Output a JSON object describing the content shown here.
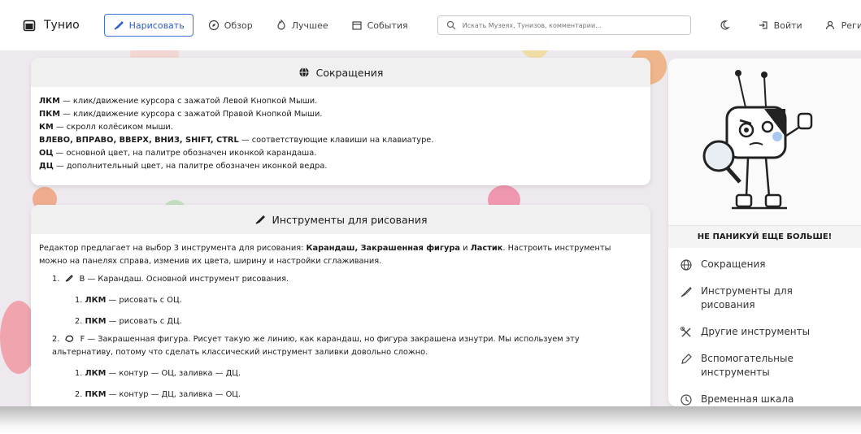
{
  "header": {
    "app_name": "Тунио",
    "nav": [
      {
        "label": "Нарисовать",
        "icon": "brush-icon"
      },
      {
        "label": "Обзор",
        "icon": "compass-icon"
      },
      {
        "label": "Лучшее",
        "icon": "fire-icon"
      },
      {
        "label": "События",
        "icon": "calendar-icon"
      }
    ],
    "search_placeholder": "Искать Музеях, Тунизов, комментарии...",
    "login": "Войти",
    "register": "Регистрация"
  },
  "abbreviations": {
    "title": "Сокращения",
    "lines": [
      {
        "term": "ЛКМ",
        "text": " — клик/движение курсора с зажатой Левой Кнопкой Мыши."
      },
      {
        "term": "ПКМ",
        "text": " — клик/движение курсора с зажатой Правой Кнопкой Мыши."
      },
      {
        "term": "КМ",
        "text": " — скролл колёсиком мыши."
      },
      {
        "term": "ВЛЕВО, ВПРАВО, ВВЕРХ, ВНИЗ, SHIFT, CTRL",
        "text": " — соответствующие клавиши на клавиатуре."
      },
      {
        "term": "ОЦ",
        "text": " — основной цвет, на палитре обозначен иконкой карандаша."
      },
      {
        "term": "ДЦ",
        "text": " — дополнительный цвет, на палитре обозначен иконкой ведра."
      }
    ]
  },
  "tools": {
    "title": "Инструменты для рисования",
    "intro_1": "Редактор предлагает на выбор 3 инструмента для рисования: ",
    "intro_tools": "Карандаш, Закрашенная фигура",
    "intro_and": " и ",
    "intro_eraser": "Ластик",
    "intro_2": ". Настроить инструменты можно на панелях справа, изменив их цвета, ширину и настройки сглаживания.",
    "items": [
      {
        "num": "1.",
        "text": "B — Карандаш. Основной инструмент рисования.",
        "sub": [
          {
            "num": "1.",
            "term": "ЛКМ",
            "text": " — рисовать с ОЦ."
          },
          {
            "num": "2.",
            "term": "ПКМ",
            "text": " — рисовать с ДЦ."
          }
        ]
      },
      {
        "num": "2.",
        "text": "F — Закрашенная фигура. Рисует такую же линию, как карандаш, но фигура закрашена изнутри. Мы используем эту альтернативу, потому что сделать классический инструмент заливки довольно сложно.",
        "sub": [
          {
            "num": "1.",
            "term": "ЛКМ",
            "text": " — контур — ОЦ, заливка — ДЦ."
          },
          {
            "num": "2.",
            "term": "ПКМ",
            "text": " — контур — ДЦ, заливка — ОЦ."
          }
        ]
      }
    ]
  },
  "sidebar": {
    "slogan": "НЕ ПАНИКУЙ ЕЩЕ БОЛЬШЕ!",
    "items": [
      {
        "label": "Сокращения",
        "icon": "globe-icon"
      },
      {
        "label": "Инструменты для рисования",
        "icon": "brush-icon"
      },
      {
        "label": "Другие инструменты",
        "icon": "tools-icon"
      },
      {
        "label": "Вспомогательные инструменты",
        "icon": "pen-icon"
      },
      {
        "label": "Временная шкала",
        "icon": "clock-icon"
      }
    ]
  },
  "colors": {
    "accent": "#3f6fd8",
    "card_header": "#f1f0f1",
    "background": "#ede9ee"
  }
}
